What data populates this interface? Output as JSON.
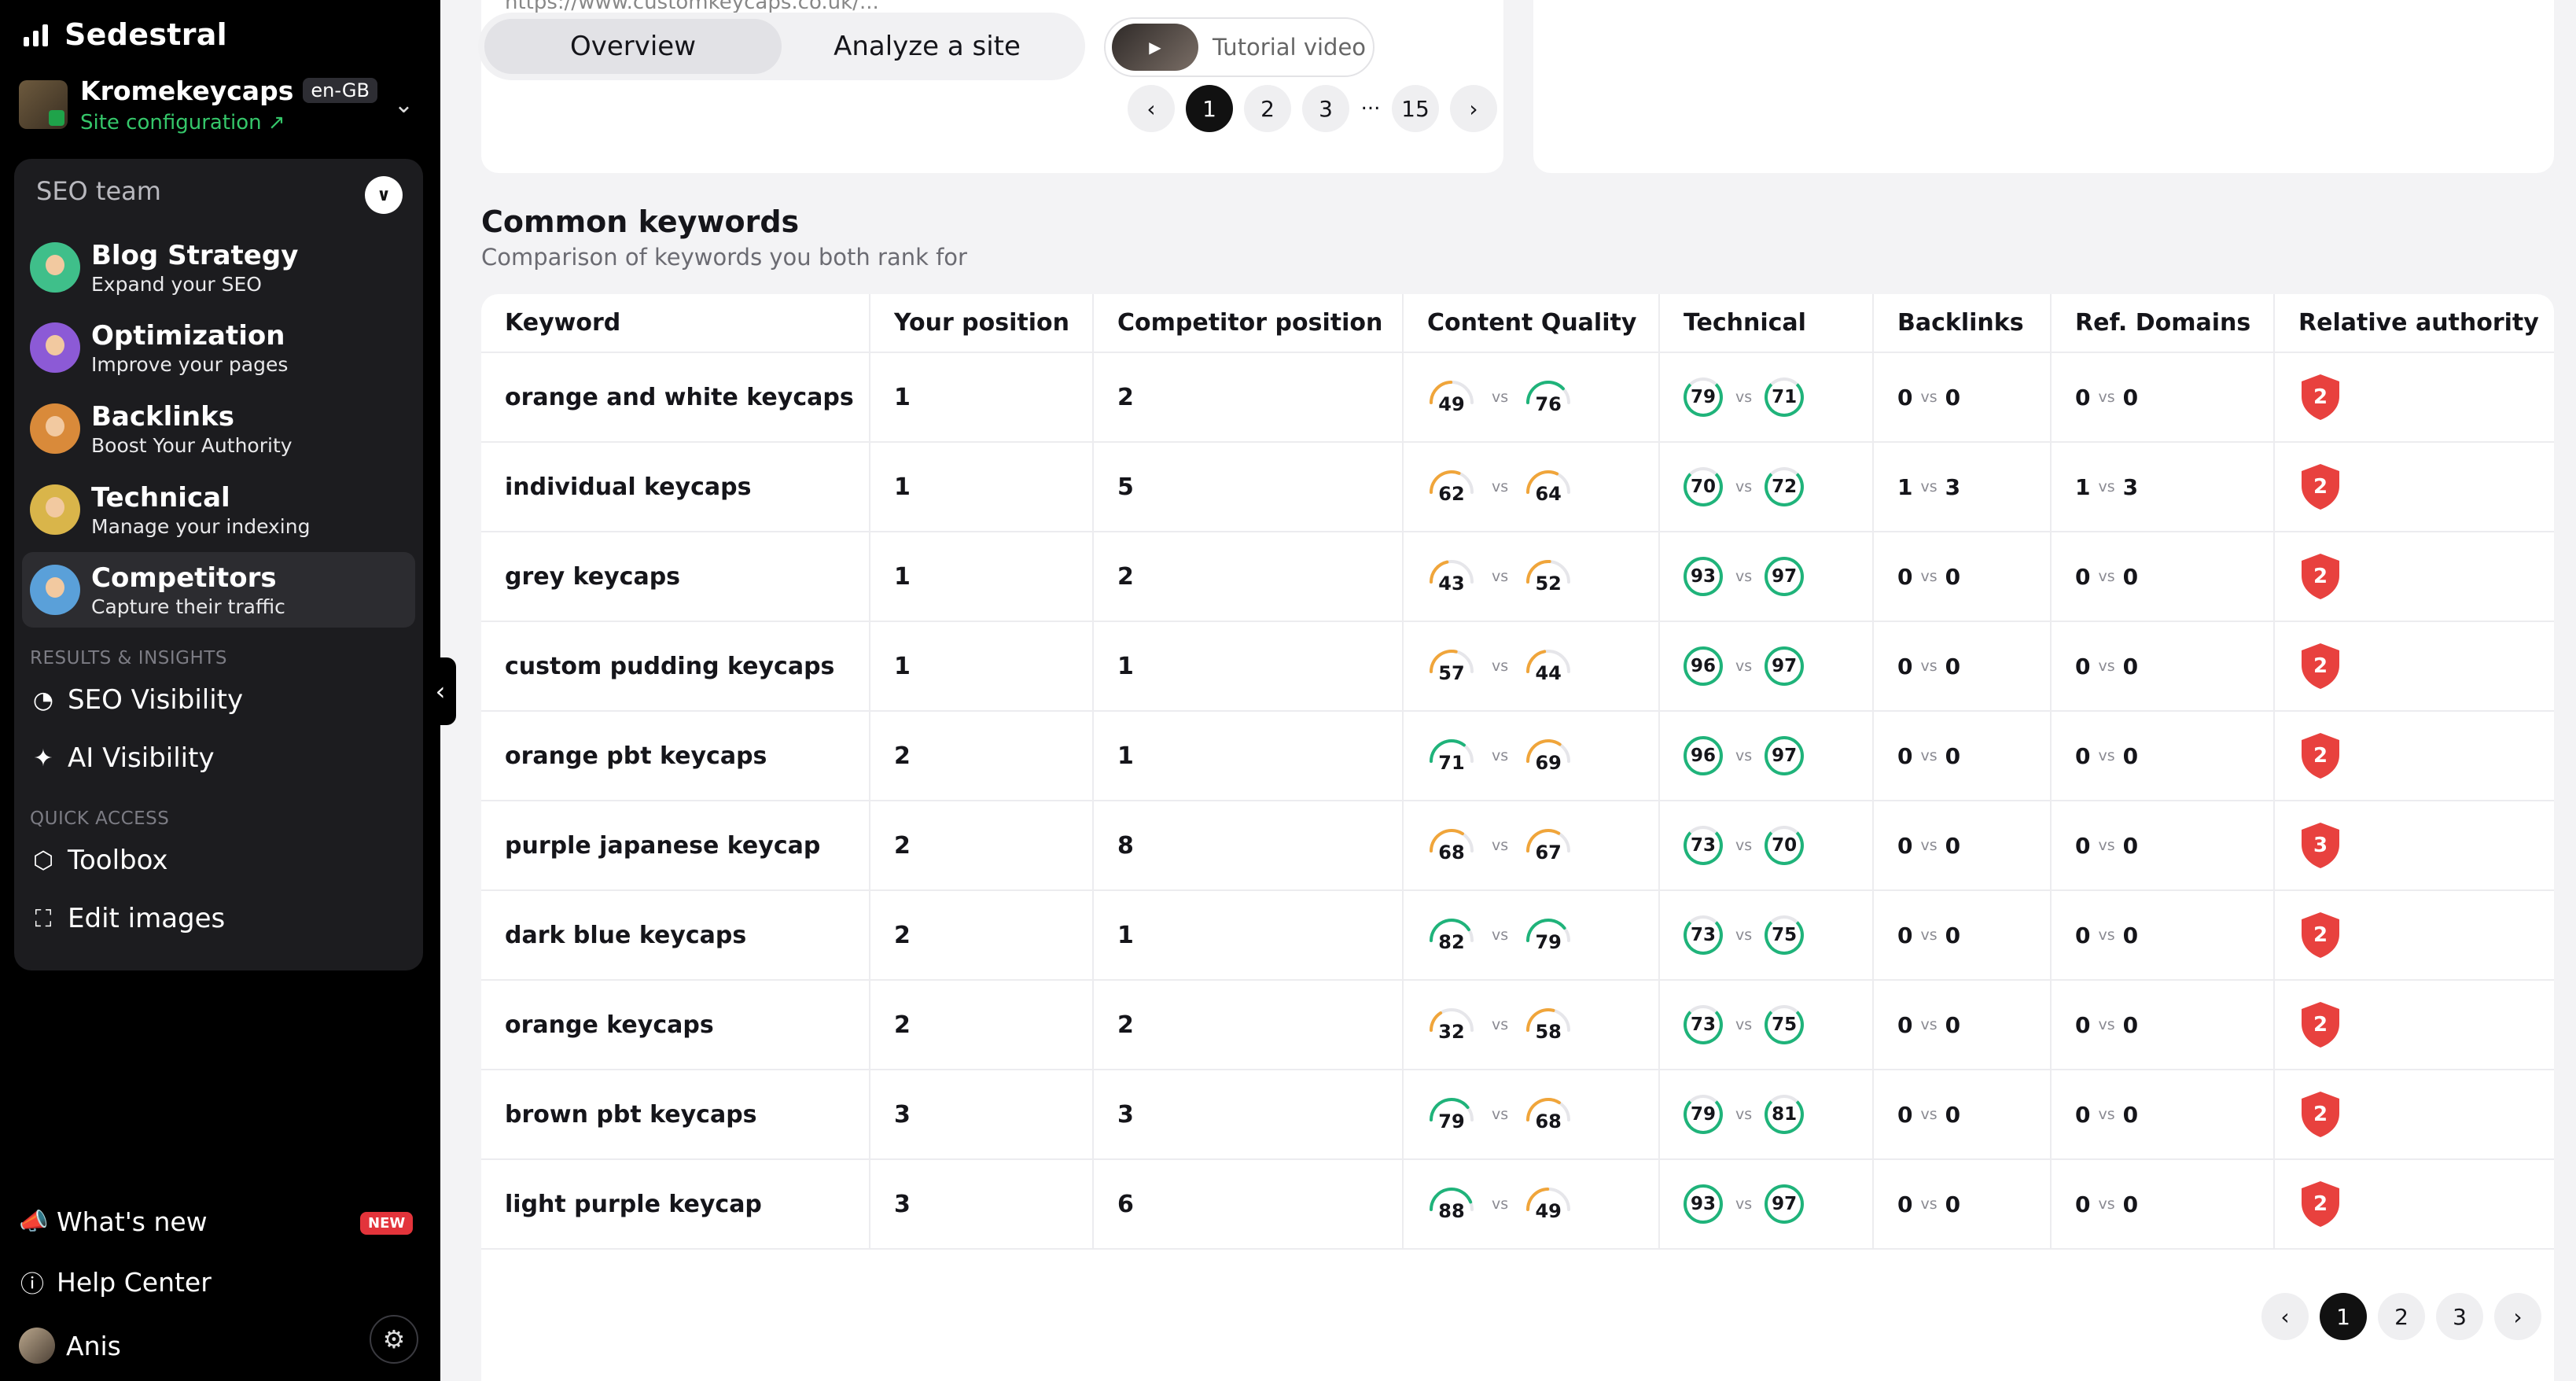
{
  "brand": {
    "name": "Sedestral"
  },
  "site": {
    "name": "Kromekeycaps",
    "lang": "en-GB",
    "config_label": "Site configuration ↗"
  },
  "team": {
    "header": "SEO team",
    "agents": [
      {
        "title": "Blog Strategy",
        "subtitle": "Expand your SEO",
        "color": "#3fbf8a"
      },
      {
        "title": "Optimization",
        "subtitle": "Improve your pages",
        "color": "#8c5ad6"
      },
      {
        "title": "Backlinks",
        "subtitle": "Boost Your Authority",
        "color": "#d98a3a"
      },
      {
        "title": "Technical",
        "subtitle": "Manage your indexing",
        "color": "#d9b54a"
      },
      {
        "title": "Competitors",
        "subtitle": "Capture their traffic",
        "color": "#5aa0d9"
      }
    ]
  },
  "nav": {
    "results_label": "RESULTS & INSIGHTS",
    "seo_visibility": "SEO Visibility",
    "ai_visibility": "AI Visibility",
    "quick_label": "QUICK ACCESS",
    "toolbox": "Toolbox",
    "edit_images": "Edit images"
  },
  "bottom": {
    "whats_new": "What's new",
    "new_badge": "NEW",
    "help": "Help Center",
    "user": "Anis"
  },
  "top": {
    "url": "https://www.customkeycaps.co.uk/...",
    "tab_overview": "Overview",
    "tab_analyze": "Analyze a site",
    "tutorial": "Tutorial video",
    "pages": [
      "1",
      "2",
      "3",
      "...",
      "15"
    ]
  },
  "section": {
    "title": "Common keywords",
    "subtitle": "Comparison of keywords you both rank for"
  },
  "table": {
    "headers": [
      "Keyword",
      "Your position",
      "Competitor position",
      "Content Quality",
      "Technical",
      "Backlinks",
      "Ref. Domains",
      "Relative authority"
    ],
    "vs": "vs",
    "rows": [
      {
        "keyword": "orange and white keycaps",
        "your": "1",
        "comp": "2",
        "cq": [
          "49",
          "76"
        ],
        "tech": [
          "79",
          "71"
        ],
        "bl": [
          "0",
          "0"
        ],
        "rd": [
          "0",
          "0"
        ],
        "auth": "2"
      },
      {
        "keyword": "individual keycaps",
        "your": "1",
        "comp": "5",
        "cq": [
          "62",
          "64"
        ],
        "tech": [
          "70",
          "72"
        ],
        "bl": [
          "1",
          "3"
        ],
        "rd": [
          "1",
          "3"
        ],
        "auth": "2"
      },
      {
        "keyword": "grey keycaps",
        "your": "1",
        "comp": "2",
        "cq": [
          "43",
          "52"
        ],
        "tech": [
          "93",
          "97"
        ],
        "bl": [
          "0",
          "0"
        ],
        "rd": [
          "0",
          "0"
        ],
        "auth": "2"
      },
      {
        "keyword": "custom pudding keycaps",
        "your": "1",
        "comp": "1",
        "cq": [
          "57",
          "44"
        ],
        "tech": [
          "96",
          "97"
        ],
        "bl": [
          "0",
          "0"
        ],
        "rd": [
          "0",
          "0"
        ],
        "auth": "2"
      },
      {
        "keyword": "orange pbt keycaps",
        "your": "2",
        "comp": "1",
        "cq": [
          "71",
          "69"
        ],
        "tech": [
          "96",
          "97"
        ],
        "bl": [
          "0",
          "0"
        ],
        "rd": [
          "0",
          "0"
        ],
        "auth": "2"
      },
      {
        "keyword": "purple japanese keycap",
        "your": "2",
        "comp": "8",
        "cq": [
          "68",
          "67"
        ],
        "tech": [
          "73",
          "70"
        ],
        "bl": [
          "0",
          "0"
        ],
        "rd": [
          "0",
          "0"
        ],
        "auth": "3"
      },
      {
        "keyword": "dark blue keycaps",
        "your": "2",
        "comp": "1",
        "cq": [
          "82",
          "79"
        ],
        "tech": [
          "73",
          "75"
        ],
        "bl": [
          "0",
          "0"
        ],
        "rd": [
          "0",
          "0"
        ],
        "auth": "2"
      },
      {
        "keyword": "orange keycaps",
        "your": "2",
        "comp": "2",
        "cq": [
          "32",
          "58"
        ],
        "tech": [
          "73",
          "75"
        ],
        "bl": [
          "0",
          "0"
        ],
        "rd": [
          "0",
          "0"
        ],
        "auth": "2"
      },
      {
        "keyword": "brown pbt keycaps",
        "your": "3",
        "comp": "3",
        "cq": [
          "79",
          "68"
        ],
        "tech": [
          "79",
          "81"
        ],
        "bl": [
          "0",
          "0"
        ],
        "rd": [
          "0",
          "0"
        ],
        "auth": "2"
      },
      {
        "keyword": "light purple keycap",
        "your": "3",
        "comp": "6",
        "cq": [
          "88",
          "49"
        ],
        "tech": [
          "93",
          "97"
        ],
        "bl": [
          "0",
          "0"
        ],
        "rd": [
          "0",
          "0"
        ],
        "auth": "2"
      }
    ]
  },
  "bottom_pages": [
    "1",
    "2",
    "3"
  ],
  "colors": {
    "green": "#1fb37a",
    "orange": "#f0a53a",
    "red": "#e8413e"
  }
}
